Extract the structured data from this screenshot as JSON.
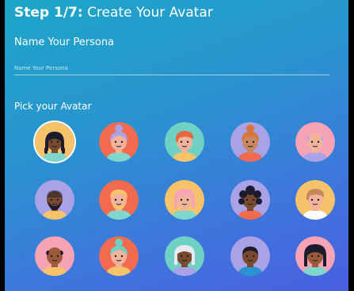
{
  "header": {
    "step": "Step 1/7:",
    "title": "Create Your Avatar"
  },
  "persona": {
    "label": "Name Your Persona",
    "placeholder": "Name Your Persona",
    "value": ""
  },
  "avatars": {
    "label": "Pick your Avatar",
    "selected_index": 0,
    "items": [
      {
        "name": "avatar-1",
        "bg": "#f6c36b",
        "skin": "#7a4a2e",
        "hair": "#1c1c2e",
        "hairStyle": "braids",
        "shirt": "#7fd6cc"
      },
      {
        "name": "avatar-2",
        "bg": "#f26b4f",
        "skin": "#f1b49a",
        "hair": "#a9a2e6",
        "hairStyle": "bun-top",
        "shirt": "#7fd6cc"
      },
      {
        "name": "avatar-3",
        "bg": "#6fd1c4",
        "skin": "#f1b49a",
        "hair": "#e4683e",
        "hairStyle": "side",
        "shirt": "#f6c36b"
      },
      {
        "name": "avatar-4",
        "bg": "#a9a2e6",
        "skin": "#c9875f",
        "hair": "#d8743a",
        "hairStyle": "bun-top",
        "shirt": "#f26b4f"
      },
      {
        "name": "avatar-5",
        "bg": "#f5a3b5",
        "skin": "#f1b49a",
        "hair": "#b3a7e8",
        "hairStyle": "bald",
        "shirt": "#a9a2e6"
      },
      {
        "name": "avatar-6",
        "bg": "#a9a2e6",
        "skin": "#7a4a2e",
        "hair": "#1c1c2e",
        "hairStyle": "beard",
        "shirt": "#f6c36b"
      },
      {
        "name": "avatar-7",
        "bg": "#f26b4f",
        "skin": "#f1b49a",
        "hair": "#f6c36b",
        "hairStyle": "beard-light",
        "shirt": "#7fd6cc"
      },
      {
        "name": "avatar-8",
        "bg": "#f6c36b",
        "skin": "#f1b49a",
        "hair": "#f5a3b5",
        "hairStyle": "long",
        "shirt": "#7fd6cc"
      },
      {
        "name": "avatar-9",
        "bg": "#a9a2e6",
        "skin": "#7a4a2e",
        "hair": "#1c1c2e",
        "hairStyle": "curly",
        "shirt": "#f26b4f"
      },
      {
        "name": "avatar-10",
        "bg": "#f6c36b",
        "skin": "#f1b49a",
        "hair": "#c9875f",
        "hairStyle": "side",
        "shirt": "#ffffff"
      },
      {
        "name": "avatar-11",
        "bg": "#f5a3b5",
        "skin": "#9b5a3a",
        "hair": "#1c1c2e",
        "hairStyle": "bald",
        "shirt": "#f6c36b"
      },
      {
        "name": "avatar-12",
        "bg": "#f26b4f",
        "skin": "#f1b49a",
        "hair": "#6fd1c4",
        "hairStyle": "bun-top",
        "shirt": "#f6c36b"
      },
      {
        "name": "avatar-13",
        "bg": "#6fd1c4",
        "skin": "#7a4a2e",
        "hair": "#e8e8f0",
        "hairStyle": "long",
        "shirt": "#a9a2e6"
      },
      {
        "name": "avatar-14",
        "bg": "#a9a2e6",
        "skin": "#7a4a2e",
        "hair": "#1c1c2e",
        "hairStyle": "short",
        "shirt": "#2a93d0"
      },
      {
        "name": "avatar-15",
        "bg": "#f5a3b5",
        "skin": "#9b5a3a",
        "hair": "#1c1c2e",
        "hairStyle": "hood",
        "shirt": "#7fd6cc"
      }
    ]
  }
}
